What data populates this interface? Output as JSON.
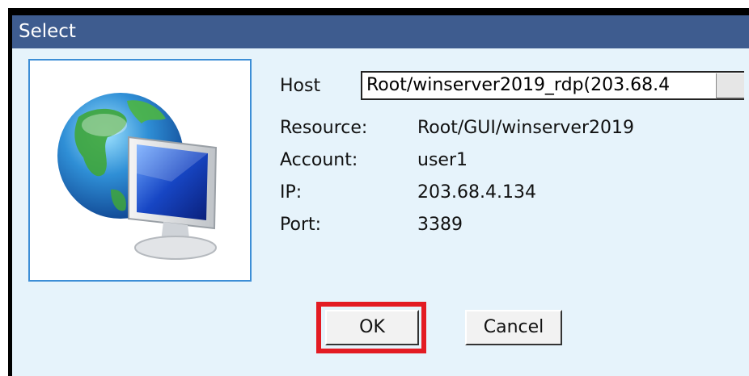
{
  "window": {
    "title": "Select"
  },
  "icon": "globe-monitor-icon",
  "host": {
    "label": "Host",
    "value": "Root/winserver2019_rdp(203.68.4"
  },
  "details": [
    {
      "label": "Resource:",
      "value": "Root/GUI/winserver2019"
    },
    {
      "label": "Account:",
      "value": "user1"
    },
    {
      "label": "IP:",
      "value": "203.68.4.134"
    },
    {
      "label": "Port:",
      "value": "3389"
    }
  ],
  "buttons": {
    "ok": "OK",
    "cancel": "Cancel"
  },
  "colors": {
    "titlebar": "#3e5c8f",
    "client": "#e6f3fb",
    "highlight": "#e31b23"
  }
}
